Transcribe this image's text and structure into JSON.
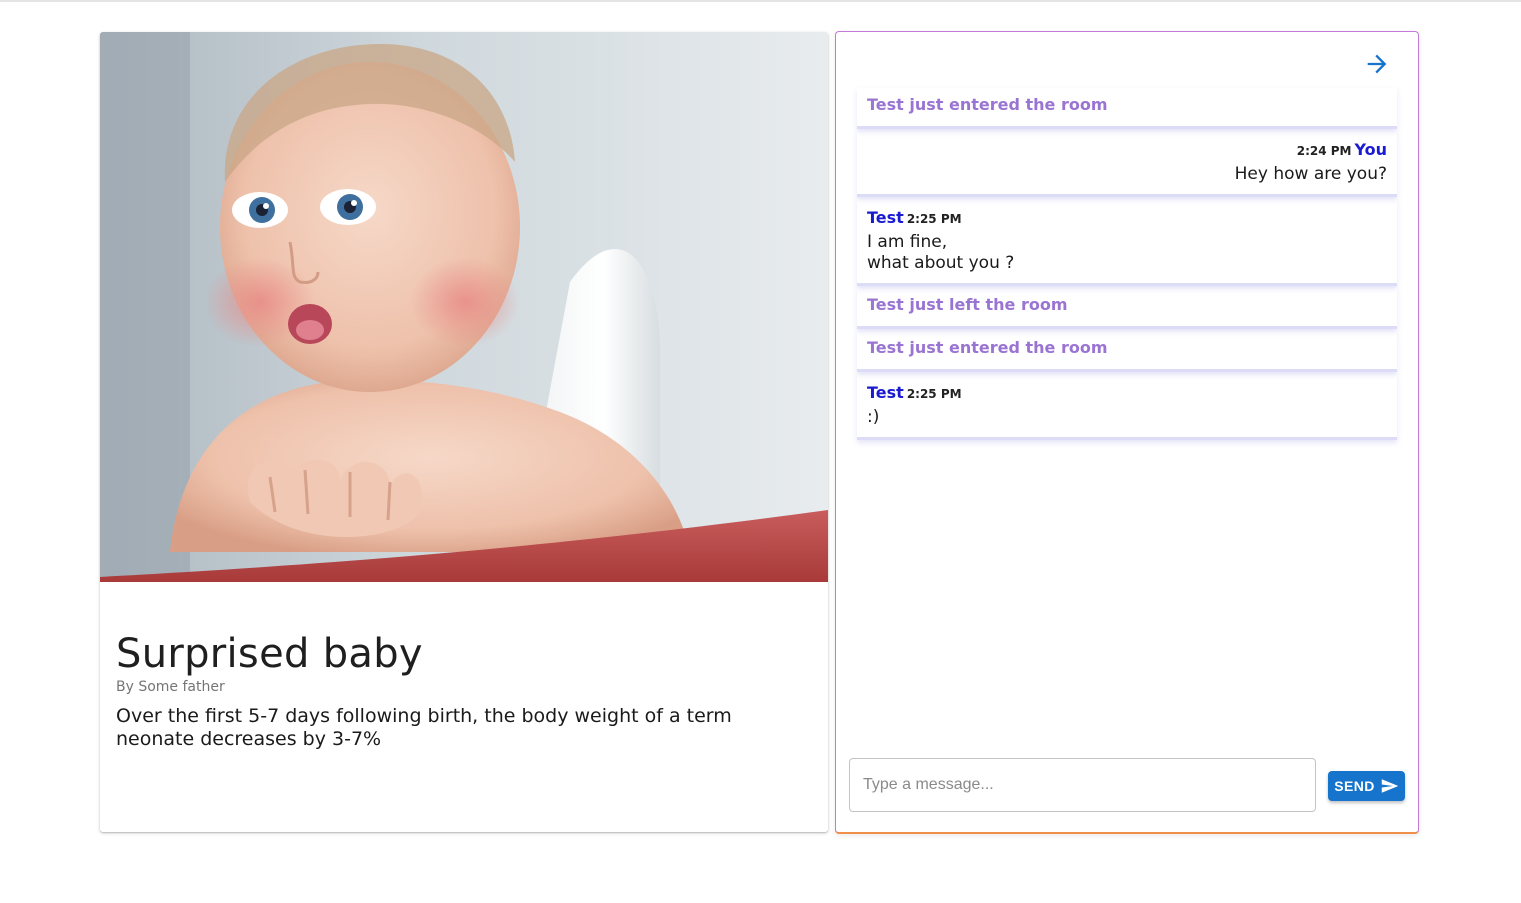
{
  "post": {
    "image_alt": "Surprised baby photo",
    "title": "Surprised baby",
    "author": "By Some father",
    "body": "Over the first 5-7 days following birth, the body weight of a term neonate decreases by 3-7%"
  },
  "chat": {
    "forward_icon": "arrow-right-icon",
    "messages": [
      {
        "type": "system",
        "text": "Test just entered the room"
      },
      {
        "type": "own",
        "sender": "You",
        "time": "2:24 PM",
        "text": "Hey how are you?"
      },
      {
        "type": "other",
        "sender": "Test",
        "time": "2:25 PM",
        "text": "I am fine,\nwhat about you ?"
      },
      {
        "type": "system",
        "text": "Test just left the room"
      },
      {
        "type": "system",
        "text": "Test just entered the room"
      },
      {
        "type": "other",
        "sender": "Test",
        "time": "2:25 PM",
        "text": ":)"
      }
    ],
    "input": {
      "placeholder": "Type a message...",
      "value": ""
    },
    "send_label": "SEND",
    "send_icon": "send-icon"
  },
  "colors": {
    "accent": "#1674cc",
    "system_text": "#9a74d2",
    "sender_name": "#1a1ad2",
    "panel_border": "#c57ad9",
    "panel_border_bottom": "#ef8f4a"
  }
}
